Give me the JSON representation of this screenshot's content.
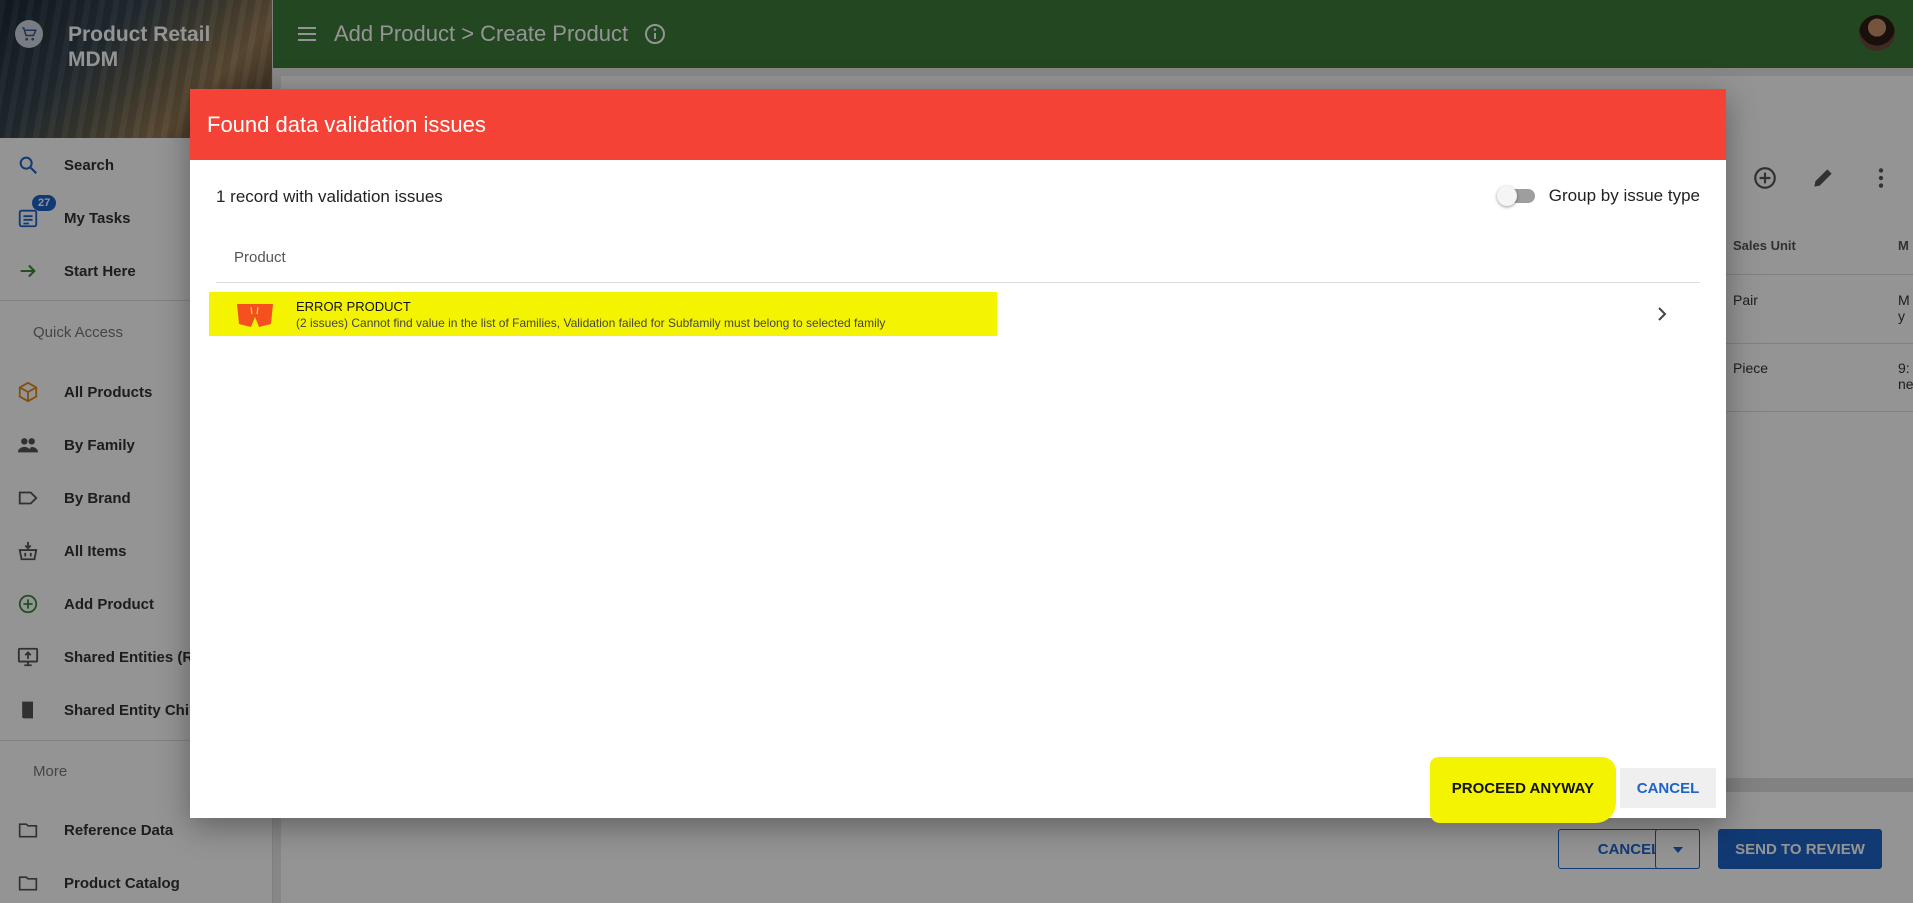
{
  "app": {
    "title": "Product Retail MDM"
  },
  "topbar": {
    "breadcrumb": "Add Product > Create Product"
  },
  "sidebar": {
    "badge_count": "27",
    "main_items": [
      {
        "label": "Search",
        "icon": "search-icon"
      },
      {
        "label": "My Tasks",
        "icon": "tasks-icon"
      },
      {
        "label": "Start Here",
        "icon": "arrow-right-icon"
      }
    ],
    "quick_access_label": "Quick Access",
    "quick_items": [
      {
        "label": "All Products",
        "icon": "cube-icon"
      },
      {
        "label": "By Family",
        "icon": "people-icon"
      },
      {
        "label": "By Brand",
        "icon": "label-icon"
      },
      {
        "label": "All Items",
        "icon": "basket-icon"
      },
      {
        "label": "Add Product",
        "icon": "add-circle-icon"
      },
      {
        "label": "Shared Entities (R",
        "icon": "monitor-icon"
      },
      {
        "label": "Shared Entity Chil",
        "icon": "book-icon"
      }
    ],
    "more_label": "More",
    "more_items": [
      {
        "label": "Reference Data",
        "icon": "folder-icon"
      },
      {
        "label": "Product Catalog",
        "icon": "folder-icon"
      }
    ]
  },
  "background_table": {
    "columns": [
      "Sales Unit",
      "M"
    ],
    "rows": [
      {
        "sales_unit": "Pair",
        "extra_line1": "M",
        "extra_line2": "y"
      },
      {
        "sales_unit": "Piece",
        "extra_line1": "9:",
        "extra_line2": "ne"
      }
    ],
    "cancel_label": "CANCEL",
    "send_label": "SEND TO REVIEW"
  },
  "dialog": {
    "title": "Found data validation issues",
    "summary": "1 record with validation issues",
    "group_toggle_label": "Group by issue type",
    "group_toggle_on": false,
    "column_header": "Product",
    "records": [
      {
        "name": "ERROR PRODUCT",
        "issues": "(2 issues) Cannot find value in the list of Families, Validation failed for Subfamily must belong to selected family"
      }
    ],
    "proceed_label": "PROCEED ANYWAY",
    "cancel_label": "CANCEL"
  },
  "colors": {
    "topbar": "#3b7a3a",
    "dialog_header": "#f44336",
    "accent_blue": "#1e64c8",
    "highlight": "#f4f400"
  }
}
